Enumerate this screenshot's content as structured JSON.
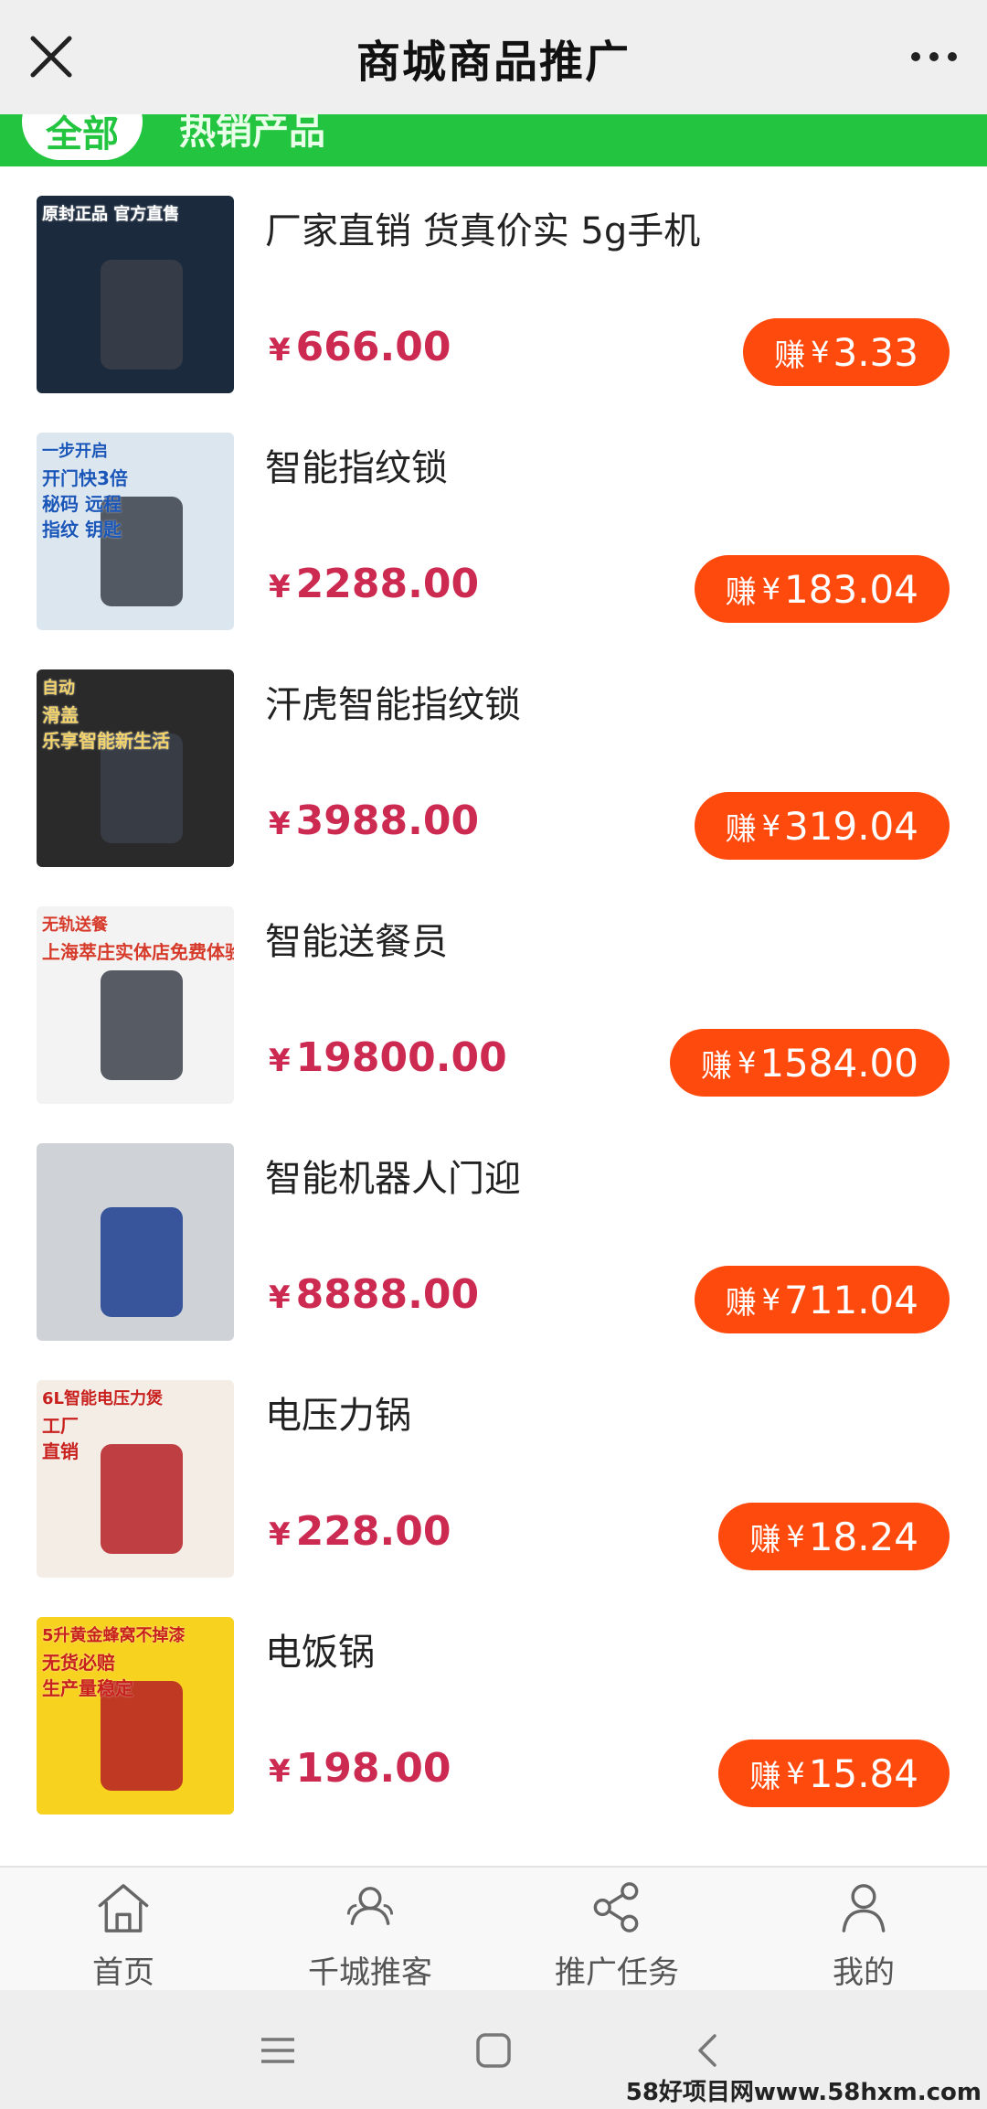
{
  "header": {
    "title": "商城商品推广",
    "close_icon": "close-icon",
    "more_icon": "more-dots-icon"
  },
  "categories": {
    "active": "全部",
    "other": "热销产品"
  },
  "currency": "¥",
  "earn_prefix": "赚",
  "products": [
    {
      "name": "厂家直销 货真价实 5g手机",
      "price": "666.00",
      "earn": "3.33",
      "thumb_text": [
        "原封正品 官方直售"
      ],
      "thumb_bg": "#1b2a3d",
      "thumb_fg": "#ffffff"
    },
    {
      "name": "智能指纹锁",
      "price": "2288.00",
      "earn": "183.04",
      "thumb_text": [
        "一步开启",
        "开门快3倍",
        "秘码 远程",
        "指纹 钥匙"
      ],
      "thumb_bg": "#dbe6ef",
      "thumb_fg": "#1a56b8"
    },
    {
      "name": "汗虎智能指纹锁",
      "price": "3988.00",
      "earn": "319.04",
      "thumb_text": [
        "自动",
        "滑盖",
        "乐享智能新生活"
      ],
      "thumb_bg": "#2a2a2a",
      "thumb_fg": "#f2d36b"
    },
    {
      "name": "智能送餐员",
      "price": "19800.00",
      "earn": "1584.00",
      "thumb_text": [
        "无轨送餐",
        "上海萃庄实体店免费体验"
      ],
      "thumb_bg": "#f3f3f3",
      "thumb_fg": "#d63a2a"
    },
    {
      "name": "智能机器人门迎",
      "price": "8888.00",
      "earn": "711.04",
      "thumb_text": [],
      "thumb_bg": "#cfd2d6",
      "thumb_fg": "#1d3f91"
    },
    {
      "name": "电压力锅",
      "price": "228.00",
      "earn": "18.24",
      "thumb_text": [
        "6L智能电压力煲",
        "工厂",
        "直销"
      ],
      "thumb_bg": "#f4ede6",
      "thumb_fg": "#c8201c"
    },
    {
      "name": "电饭锅",
      "price": "198.00",
      "earn": "15.84",
      "thumb_text": [
        "5升黄金蜂窝不掉漆",
        "无货必赔",
        "生产量稳定"
      ],
      "thumb_bg": "#f7d21f",
      "thumb_fg": "#c8201c"
    }
  ],
  "tabs": [
    {
      "label": "首页",
      "icon": "home-icon"
    },
    {
      "label": "千城推客",
      "icon": "users-icon"
    },
    {
      "label": "推广任务",
      "icon": "share-icon"
    },
    {
      "label": "我的",
      "icon": "person-icon"
    }
  ],
  "system_nav": {
    "menu_icon": "menu-icon",
    "home_icon": "square-home-icon",
    "back_icon": "back-icon"
  },
  "watermark": "58好项目网www.58hxm.com"
}
